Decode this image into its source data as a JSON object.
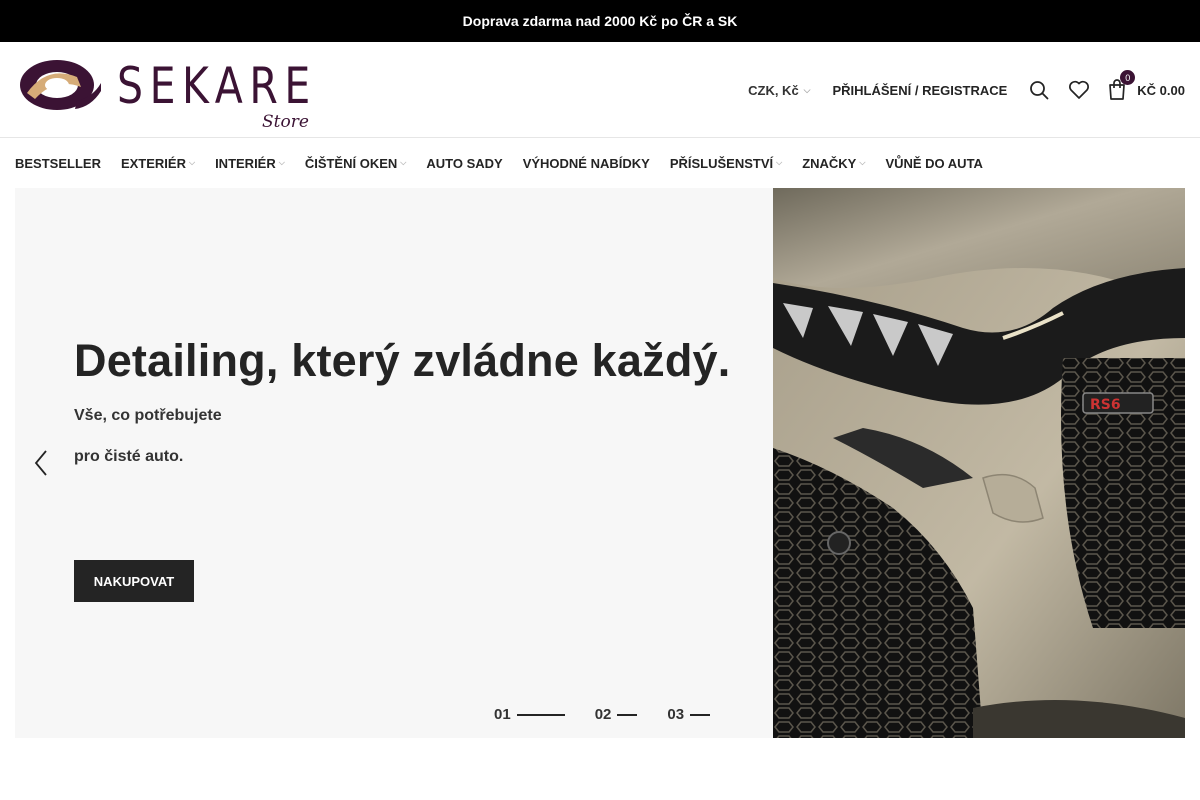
{
  "topbar": {
    "text": "Doprava zdarma nad 2000 Kč po ČR a SK"
  },
  "logo": {
    "word": "SEKARE",
    "sub": "Store"
  },
  "header": {
    "currency": "CZK, Kč",
    "login": "Přihlášení / Registrace",
    "cart_count": "0",
    "cart_total": "Kč 0.00"
  },
  "nav": [
    {
      "label": "Bestseller",
      "dropdown": false
    },
    {
      "label": "Exteriér",
      "dropdown": true
    },
    {
      "label": "Interiér",
      "dropdown": true
    },
    {
      "label": "Čištění oken",
      "dropdown": true
    },
    {
      "label": "Auto sady",
      "dropdown": false
    },
    {
      "label": "Výhodné nabídky",
      "dropdown": false
    },
    {
      "label": "Příslušenství",
      "dropdown": true
    },
    {
      "label": "Značky",
      "dropdown": true
    },
    {
      "label": "Vůně do auta",
      "dropdown": false
    }
  ],
  "hero": {
    "title": "Detailing, který zvládne každý.",
    "line1": "Vše, co potřebujete",
    "line2": "pro čisté auto.",
    "cta": "Nakupovat",
    "slides": [
      "01",
      "02",
      "03"
    ],
    "active_slide": 0
  },
  "colors": {
    "brand": "#3b1334",
    "accent": "#d6ac78",
    "dark": "#242424"
  },
  "icons": [
    "search-icon",
    "heart-icon",
    "cart-icon",
    "chevron-down-icon",
    "arrow-left-icon"
  ]
}
